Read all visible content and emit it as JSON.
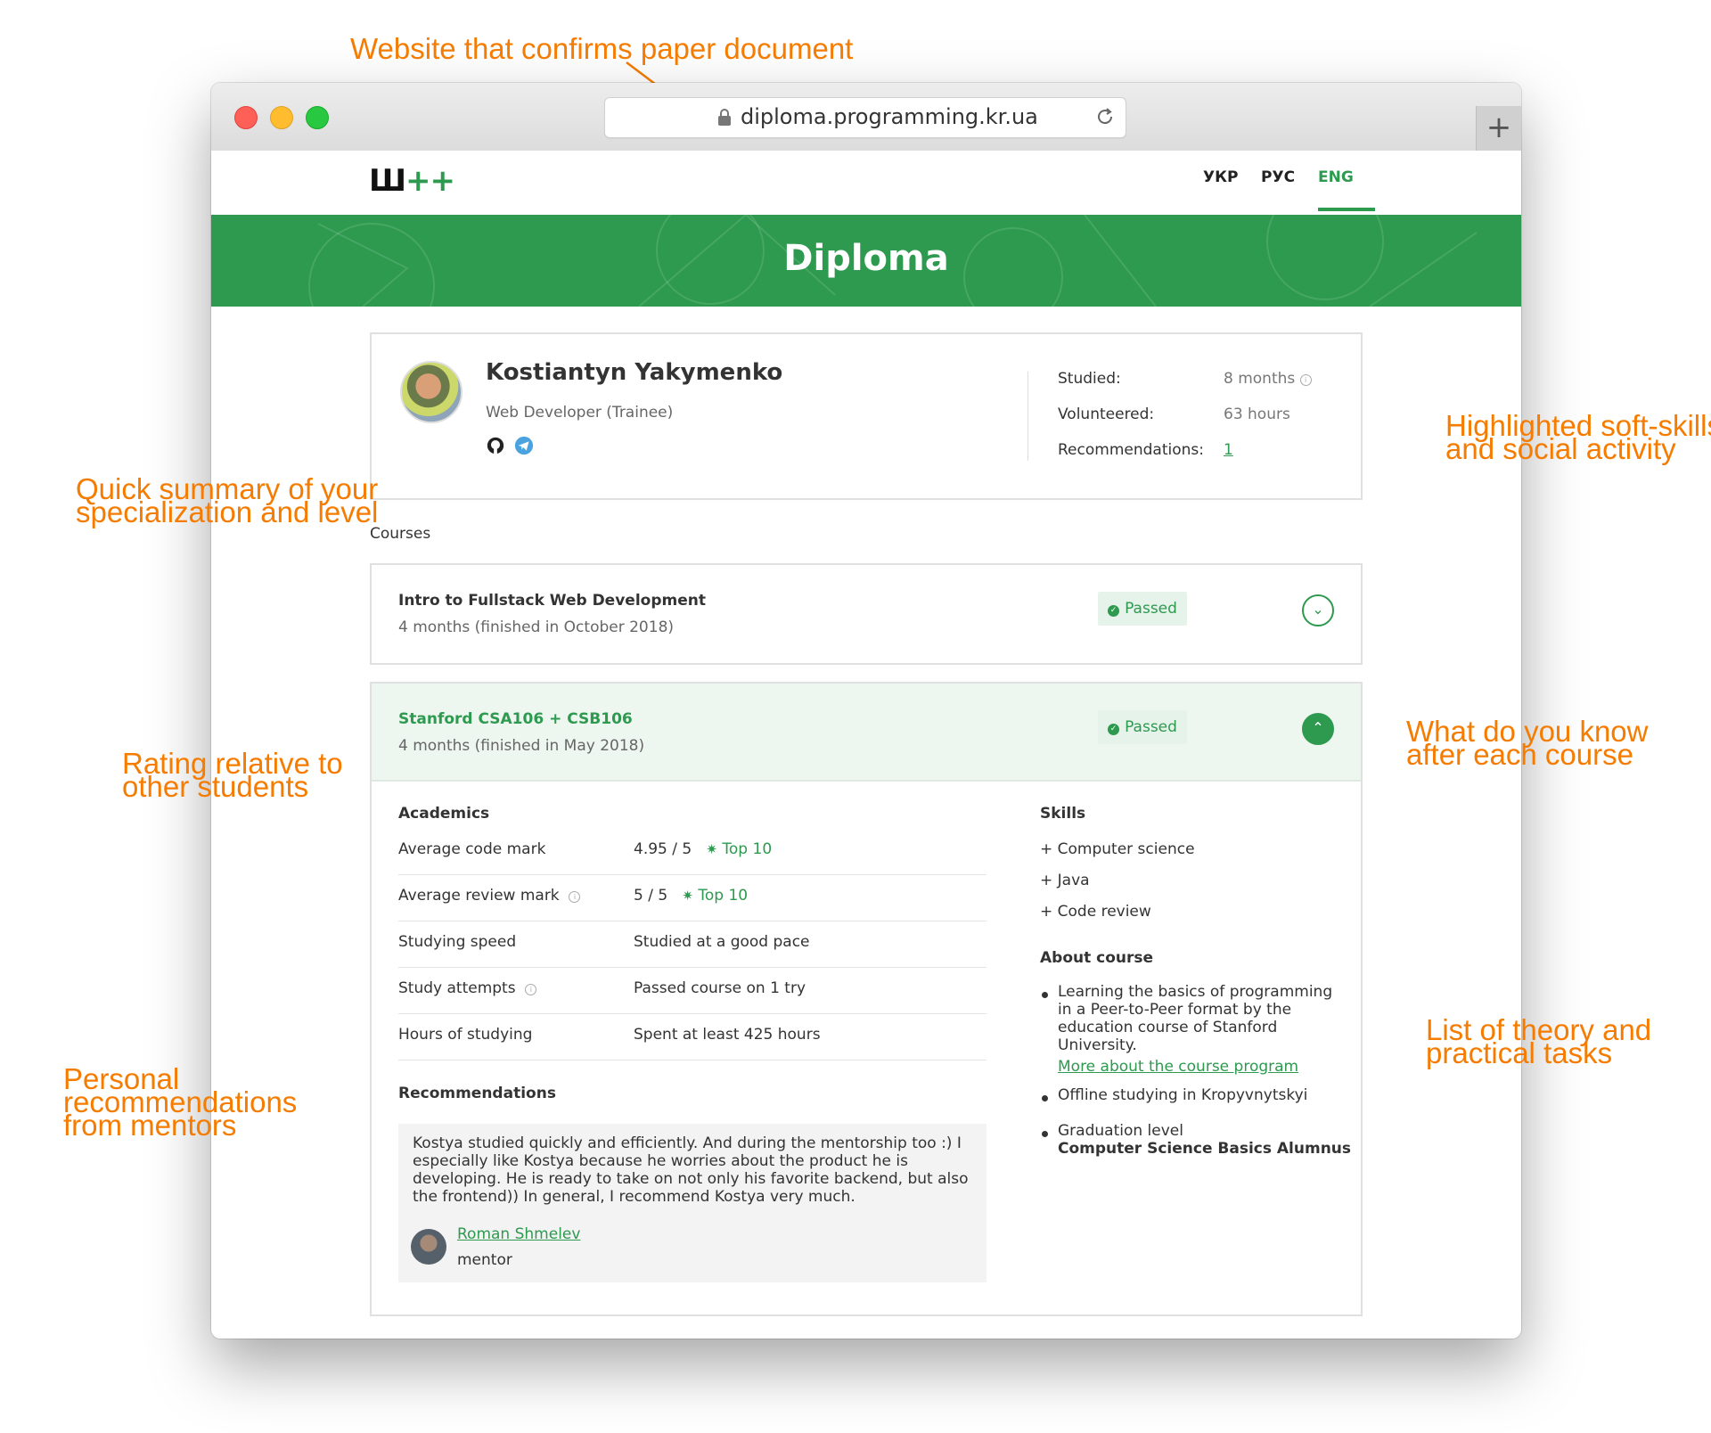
{
  "annotations": {
    "website": "Website that confirms paper document",
    "summary_1": "Quick summary of your",
    "summary_2": "specialization and level",
    "softskills_1": "Highlighted soft-skills",
    "softskills_2": "and social activity",
    "know_1": "What do you know",
    "know_2": "after each course",
    "rating_1": "Rating relative to",
    "rating_2": "other students",
    "recs_1": "Personal",
    "recs_2": "recommendations",
    "recs_3": "from mentors",
    "tasks_1": "List of theory and",
    "tasks_2": "practical tasks"
  },
  "browser": {
    "url": "diploma.programming.kr.ua",
    "newtab_label": "+"
  },
  "site": {
    "logo_text": "Ш",
    "logo_plus": "++",
    "languages": [
      "УКР",
      "РУС",
      "ENG"
    ],
    "active_language": "ENG",
    "page_title": "Diploma"
  },
  "profile": {
    "name": "Kostiantyn Yakymenko",
    "role": "Web Developer (Trainee)",
    "stats": {
      "studied_label": "Studied:",
      "studied_value": "8 months",
      "volunteered_label": "Volunteered:",
      "volunteered_value": "63 hours",
      "recommendations_label": "Recommendations:",
      "recommendations_value": "1"
    }
  },
  "courses_label": "Courses",
  "courses": [
    {
      "title": "Intro to Fullstack Web Development",
      "duration": "4 months (finished in October 2018)",
      "status": "Passed"
    },
    {
      "title": "Stanford CSA106 + CSB106",
      "duration": "4 months (finished in May 2018)",
      "status": "Passed"
    }
  ],
  "academics": {
    "title": "Academics",
    "rows": [
      {
        "label": "Average code mark",
        "value": "4.95 / 5",
        "rank": "Top 10"
      },
      {
        "label": "Average review mark",
        "value": "5 / 5",
        "rank": "Top 10"
      },
      {
        "label": "Studying speed",
        "value": "Studied at a good pace"
      },
      {
        "label": "Study attempts",
        "value": "Passed course on 1 try"
      },
      {
        "label": "Hours of studying",
        "value": "Spent at least 425 hours"
      }
    ]
  },
  "recommendations": {
    "title": "Recommendations",
    "text_1": "Kostya studied quickly and efficiently. And during the mentorship too :) I",
    "text_2": "especially like Kostya because he worries about the product he is",
    "text_3": "developing. He is ready to take on not only his favorite backend, but also",
    "text_4": "the frontend)) In general, I recommend Kostya very much.",
    "mentor_name": "Roman Shmelev",
    "mentor_role": "mentor"
  },
  "skills": {
    "title": "Skills",
    "items": [
      "+ Computer science",
      "+ Java",
      "+ Code review"
    ]
  },
  "about": {
    "title": "About course",
    "item1_1": "Learning the basics of programming",
    "item1_2": "in a Peer-to-Peer format by the",
    "item1_3": "education course of Stanford",
    "item1_4": "University.",
    "item1_link": "More about the course program",
    "item2": "Offline studying in Kropyvnytskyi",
    "item3_1": "Graduation level",
    "item3_2": "Computer Science Basics Alumnus"
  },
  "colors": {
    "brand_green": "#2d9a4f",
    "annotation_orange": "#f57c00"
  }
}
